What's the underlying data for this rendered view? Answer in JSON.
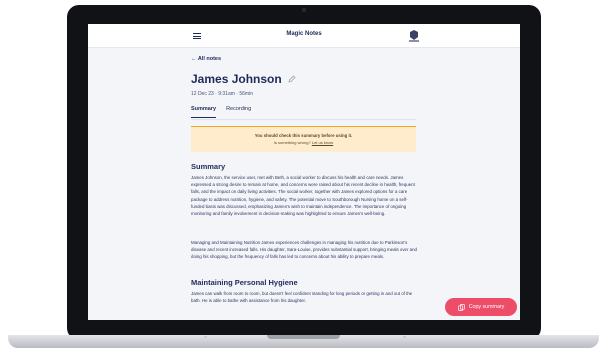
{
  "app": {
    "title": "Magic Notes",
    "back_label": "← All notes"
  },
  "note": {
    "person_name": "James Johnson",
    "meta": "12 Dec 23 · 9:31am · 56min"
  },
  "tabs": [
    {
      "label": "Summary",
      "active": true
    },
    {
      "label": "Recording",
      "active": false
    }
  ],
  "warning": {
    "title": "You should check this summary before using it.",
    "question": "Is something wrong?",
    "link": "Let us know"
  },
  "sections": [
    {
      "heading": "Summary",
      "paragraphs": [
        "James Johnson, the service user, met with Beth, a social worker to discuss his health and care needs. James expressed a strong desire to remain at home, and concerns were raised about his recent decline in health, frequent falls, and the impact on daily living activities. The social worker, together with James explored options for a care package to address nutrition, hygiene, and safety. The potential move to Southborough Nursing home on a self-funded basis was discussed, emphasizing James's wish to maintain independence. The importance of ongoing monitoring and family involvement in decision-making was highlighted to ensure James's well-being.",
        "Managing and Maintaining Nutrition James experiences challenges in managing his nutrition due to Parkinson's disease and recent increased falls. His daughter, Sara-Louise, provides substantial support, bringing meals over and doing his shopping, but the frequency of falls has led to concerns about his ability to prepare meals."
      ]
    },
    {
      "heading": "Maintaining Personal Hygiene",
      "paragraphs": [
        "James can walk from room to room, but doesn't feel confident standing for long periods or getting in and out of the bath. He is able to bathe with assistance from his daughter."
      ]
    }
  ],
  "actions": {
    "copy_label": "Copy summary"
  },
  "colors": {
    "accent": "#ee4d6a",
    "warning_border": "#f6a623",
    "warning_bg": "#ffeccd",
    "text": "#1e2a5a"
  },
  "icons": [
    "menu-icon",
    "org-logo",
    "pencil-icon",
    "copy-icon"
  ]
}
